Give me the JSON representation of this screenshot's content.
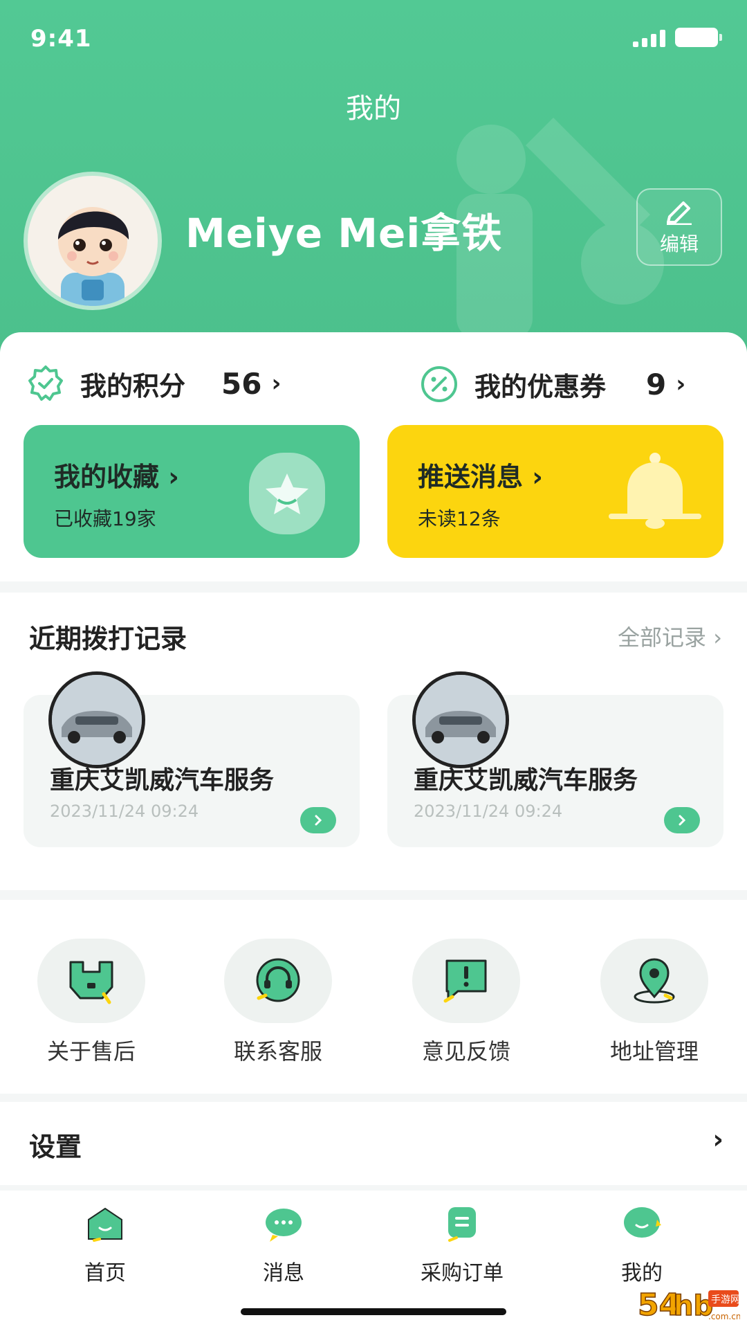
{
  "status_bar": {
    "time": "9:41"
  },
  "header": {
    "title": "我的"
  },
  "profile": {
    "username": "Meiye Mei拿铁",
    "edit_label": "编辑"
  },
  "stats": {
    "points": {
      "label": "我的积分",
      "value": "56"
    },
    "coupons": {
      "label": "我的优惠券",
      "value": "9"
    }
  },
  "tiles": {
    "favorites": {
      "title": "我的收藏",
      "subtitle": "已收藏19家"
    },
    "notifications": {
      "title": "推送消息",
      "subtitle": "未读12条"
    }
  },
  "recent_calls": {
    "title": "近期拨打记录",
    "view_all": "全部记录",
    "items": [
      {
        "name": "重庆艾凯威汽车服务",
        "time": "2023/11/24 09:24"
      },
      {
        "name": "重庆艾凯威汽车服务",
        "time": "2023/11/24 09:24"
      }
    ]
  },
  "services": [
    {
      "label": "关于售后",
      "icon": "wrench-icon"
    },
    {
      "label": "联系客服",
      "icon": "headset-icon"
    },
    {
      "label": "意见反馈",
      "icon": "feedback-icon"
    },
    {
      "label": "地址管理",
      "icon": "location-pin-icon"
    }
  ],
  "settings": {
    "label": "设置"
  },
  "tabbar": [
    {
      "label": "首页",
      "icon": "home-icon"
    },
    {
      "label": "消息",
      "icon": "chat-icon"
    },
    {
      "label": "采购订单",
      "icon": "order-icon"
    },
    {
      "label": "我的",
      "icon": "profile-icon"
    }
  ],
  "watermark": {
    "text": "54hb手游网"
  },
  "colors": {
    "primary": "#4ec690",
    "accent_yellow": "#fcd50f",
    "text": "#222222",
    "muted": "#9aa3a1"
  }
}
